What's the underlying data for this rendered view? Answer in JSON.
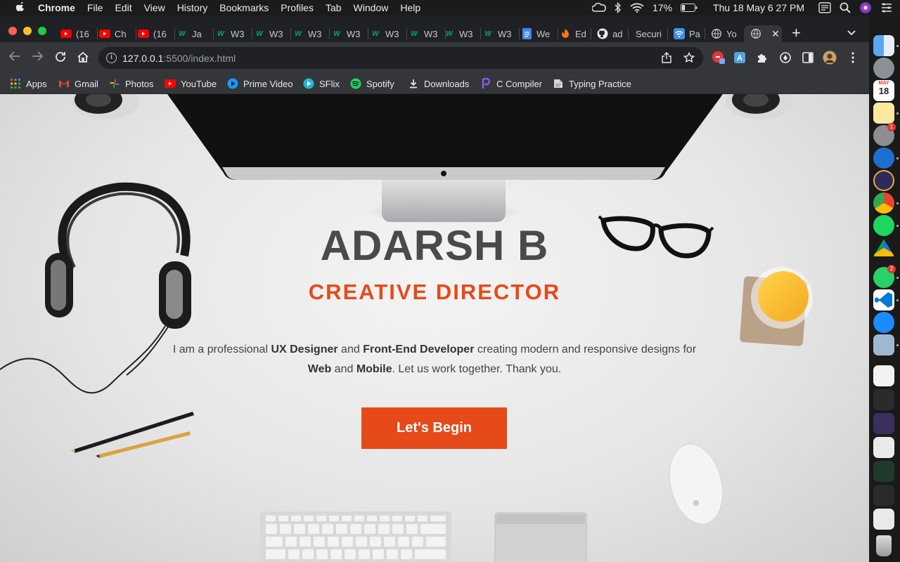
{
  "menubar": {
    "app_name": "Chrome",
    "items": [
      "File",
      "Edit",
      "View",
      "History",
      "Bookmarks",
      "Profiles",
      "Tab",
      "Window",
      "Help"
    ],
    "battery": "17%",
    "datetime": "Thu 18 May  6 27 PM"
  },
  "tabs": [
    {
      "label": "(16",
      "icon": "youtube-icon"
    },
    {
      "label": "Ch",
      "icon": "youtube-icon"
    },
    {
      "label": "(16",
      "icon": "youtube-icon"
    },
    {
      "label": "Ja",
      "icon": "w3schools-icon"
    },
    {
      "label": "W3",
      "icon": "w3schools-icon"
    },
    {
      "label": "W3",
      "icon": "w3schools-icon"
    },
    {
      "label": "W3",
      "icon": "w3schools-icon"
    },
    {
      "label": "W3",
      "icon": "w3schools-icon"
    },
    {
      "label": "W3",
      "icon": "w3schools-icon"
    },
    {
      "label": "W3",
      "icon": "w3schools-icon"
    },
    {
      "label": "W3",
      "icon": "w3schools-icon"
    },
    {
      "label": "W3",
      "icon": "w3schools-icon"
    },
    {
      "label": "W3",
      "icon": "w3schools-icon"
    },
    {
      "label": "We",
      "icon": "docs-icon"
    },
    {
      "label": "Ed",
      "icon": "codepen-icon"
    },
    {
      "label": "ad",
      "icon": "github-icon"
    },
    {
      "label": "Securi",
      "icon": "none"
    },
    {
      "label": "Pa",
      "icon": "wifi-icon"
    },
    {
      "label": "Yo",
      "icon": "globe-icon"
    },
    {
      "label": "",
      "icon": "globe-icon",
      "active": true
    }
  ],
  "address": {
    "host": "127.0.0.1",
    "rest": ":5500/index.html"
  },
  "bookmarks": [
    {
      "label": "Apps",
      "icon": "apps-grid-icon"
    },
    {
      "label": "Gmail",
      "icon": "gmail-icon"
    },
    {
      "label": "Photos",
      "icon": "photos-icon"
    },
    {
      "label": "YouTube",
      "icon": "youtube-icon"
    },
    {
      "label": "Prime Video",
      "icon": "prime-video-icon"
    },
    {
      "label": "SFlix",
      "icon": "sflix-icon"
    },
    {
      "label": "Spotify",
      "icon": "spotify-icon"
    },
    {
      "label": "Downloads",
      "icon": "download-icon"
    },
    {
      "label": "C Compiler",
      "icon": "c-compiler-icon"
    },
    {
      "label": "Typing Practice",
      "icon": "typing-icon"
    }
  ],
  "hero": {
    "name": "ADARSH B",
    "role": "CREATIVE DIRECTOR",
    "desc_1": "I am a professional ",
    "desc_b1": "UX Designer",
    "desc_2": " and ",
    "desc_b2": "Front-End Developer",
    "desc_3": " creating modern and responsive designs for ",
    "desc_b3": "Web",
    "desc_4": " and ",
    "desc_b4": "Mobile",
    "desc_5": ". Let us work together. Thank you.",
    "cta": "Let's Begin"
  },
  "dock": {
    "calendar_day": "18",
    "calendar_month": "MAY",
    "settings_badge": "1",
    "whatsapp_badge": "2"
  },
  "colors": {
    "accent": "#e64a19",
    "heading": "#4a4a4a"
  }
}
